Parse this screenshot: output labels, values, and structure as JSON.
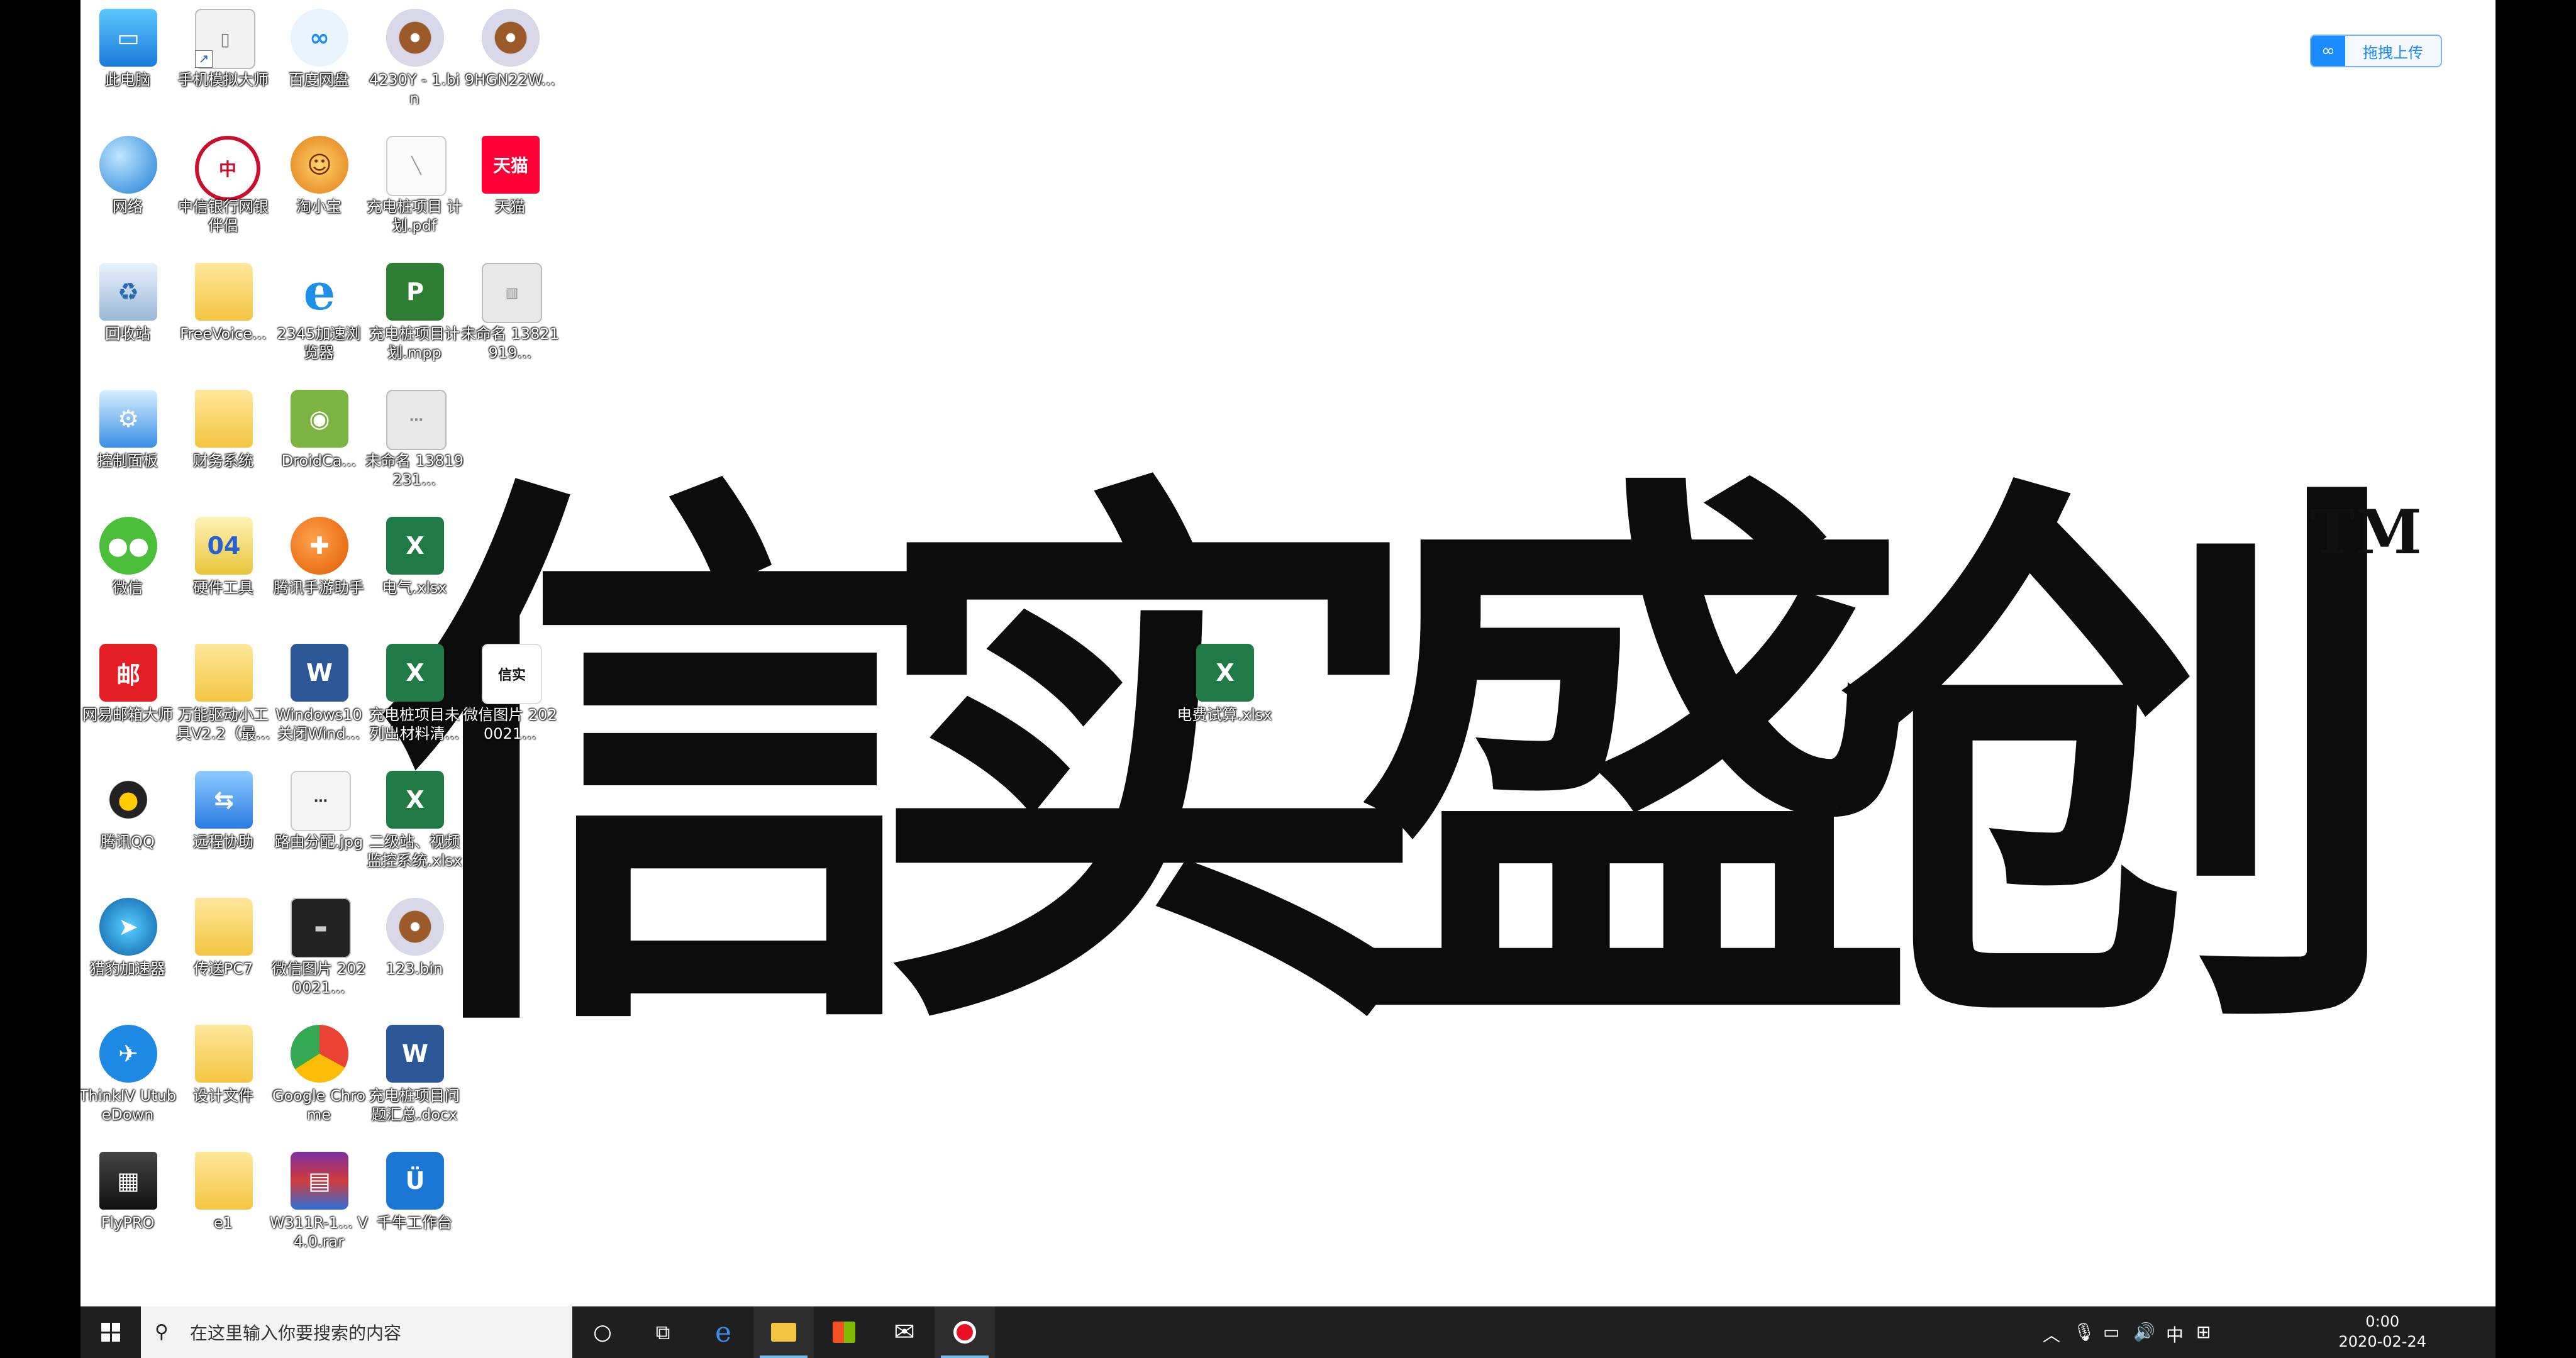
{
  "wallpaper": {
    "logo_chars": [
      "信",
      "实",
      "盛",
      "创"
    ],
    "trademark": "TM"
  },
  "desktop_icons": [
    {
      "label": "此电脑"
    },
    {
      "label": "手机模拟大师"
    },
    {
      "label": "百度网盘"
    },
    {
      "label": "4230Y - 1.bin"
    },
    {
      "label": "9HGN22W..."
    },
    {
      "label": "网络"
    },
    {
      "label": "中信银行网银 伴侣"
    },
    {
      "label": "淘小宝"
    },
    {
      "label": "充电桩项目 计划.pdf"
    },
    {
      "label": "天猫"
    },
    {
      "label": "回收站"
    },
    {
      "label": "FreeVoice..."
    },
    {
      "label": "2345加速浏 览器"
    },
    {
      "label": "充电桩项目计 划.mpp"
    },
    {
      "label": "未命名 13821919..."
    },
    {
      "label": "控制面板"
    },
    {
      "label": "财务系统"
    },
    {
      "label": "DroidCa..."
    },
    {
      "label": "未命名 13819231..."
    },
    {
      "label": "微信"
    },
    {
      "label": "硬件工具"
    },
    {
      "label": "腾讯手游助手"
    },
    {
      "label": "电气.xlsx"
    },
    {
      "label": "网易邮箱大师"
    },
    {
      "label": "万能驱动小工 具V2.2（最..."
    },
    {
      "label": "Windows10 关闭Wind..."
    },
    {
      "label": "充电桩项目未 列出材料清..."
    },
    {
      "label": "微信图片 2020021..."
    },
    {
      "label": "电费试算.xlsx"
    },
    {
      "label": "腾讯QQ"
    },
    {
      "label": "远程协助"
    },
    {
      "label": "路由分配.jpg"
    },
    {
      "label": "二级站、视频 监控系统.xlsx"
    },
    {
      "label": "猎豹加速器"
    },
    {
      "label": "传送PC7"
    },
    {
      "label": "微信图片 2020021..."
    },
    {
      "label": "123.bin"
    },
    {
      "label": "ThinkIV UtubeDown"
    },
    {
      "label": "设计文件"
    },
    {
      "label": "Google Chrome"
    },
    {
      "label": "充电桩项目问 题汇总.docx"
    },
    {
      "label": "FlyPRO"
    },
    {
      "label": "e1"
    },
    {
      "label": "W311R-1... V4.0.rar"
    },
    {
      "label": "千牛工作台"
    }
  ],
  "upload_widget": {
    "label": "拖拽上传",
    "icon": "baidu-cloud-icon"
  },
  "taskbar": {
    "search_placeholder": "在这里输入你要搜索的内容",
    "apps": [
      "cortana-icon",
      "task-view-icon",
      "edge-icon",
      "file-explorer-icon",
      "store-icon",
      "mail-icon",
      "recorder-icon"
    ],
    "tray": {
      "ime": "中",
      "time": "0:00",
      "date": "2020-02-24"
    }
  },
  "colors": {
    "taskbar": "#1f1f1f",
    "desktop": "#ffffff",
    "accent": "#76b9ed"
  }
}
